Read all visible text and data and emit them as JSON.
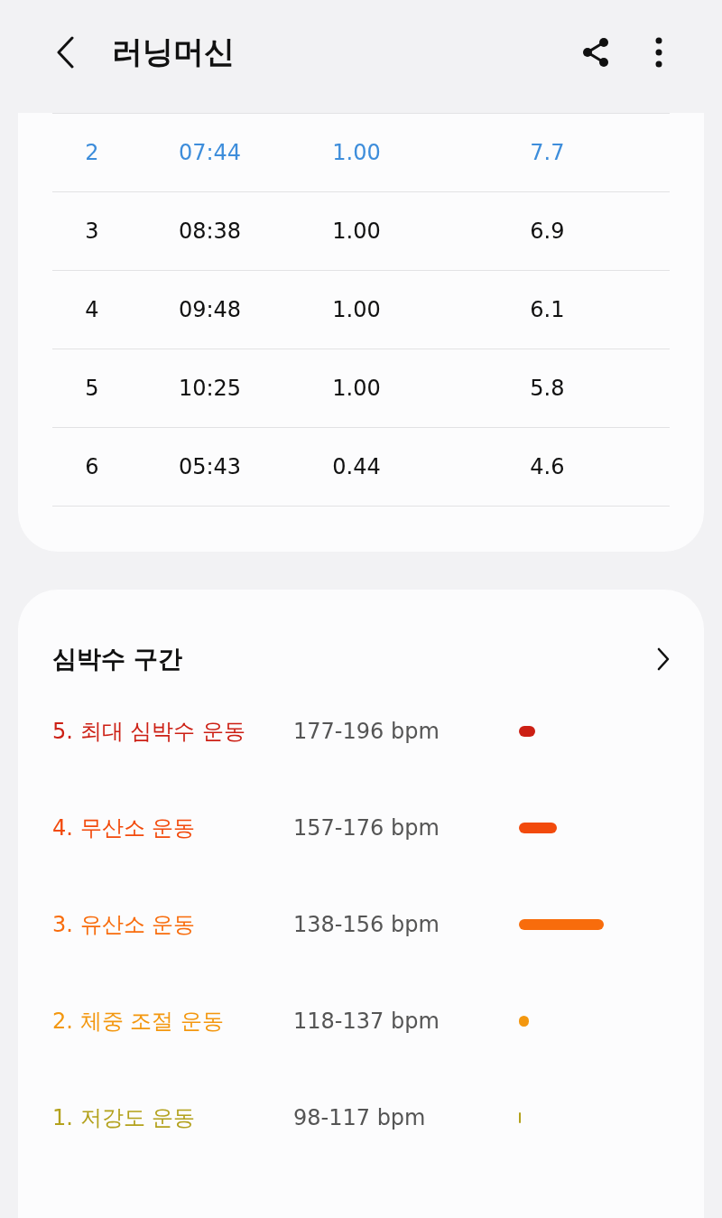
{
  "header": {
    "title": "러닝머신"
  },
  "laps": [
    {
      "cells": [
        "2",
        "07:44",
        "1.00",
        "7.7"
      ],
      "highlighted": true
    },
    {
      "cells": [
        "3",
        "08:38",
        "1.00",
        "6.9"
      ],
      "highlighted": false
    },
    {
      "cells": [
        "4",
        "09:48",
        "1.00",
        "6.1"
      ],
      "highlighted": false
    },
    {
      "cells": [
        "5",
        "10:25",
        "1.00",
        "5.8"
      ],
      "highlighted": false
    },
    {
      "cells": [
        "6",
        "05:43",
        "0.44",
        "4.6"
      ],
      "highlighted": false
    }
  ],
  "heart_rate_zones": {
    "title": "심박수 구간",
    "zones": [
      {
        "label": "5. 최대 심박수 운동",
        "range": "177-196 bpm",
        "color": "#cc1f14"
      },
      {
        "label": "4. 무산소 운동",
        "range": "157-176 bpm",
        "color": "#f24a0c"
      },
      {
        "label": "3. 유산소 운동",
        "range": "138-156 bpm",
        "color": "#f86c0c"
      },
      {
        "label": "2. 체중 조절 운동",
        "range": "118-137 bpm",
        "color": "#f3970f"
      },
      {
        "label": "1. 저강도 운동",
        "range": "98-117 bpm",
        "color": "#b3a11c"
      }
    ]
  }
}
